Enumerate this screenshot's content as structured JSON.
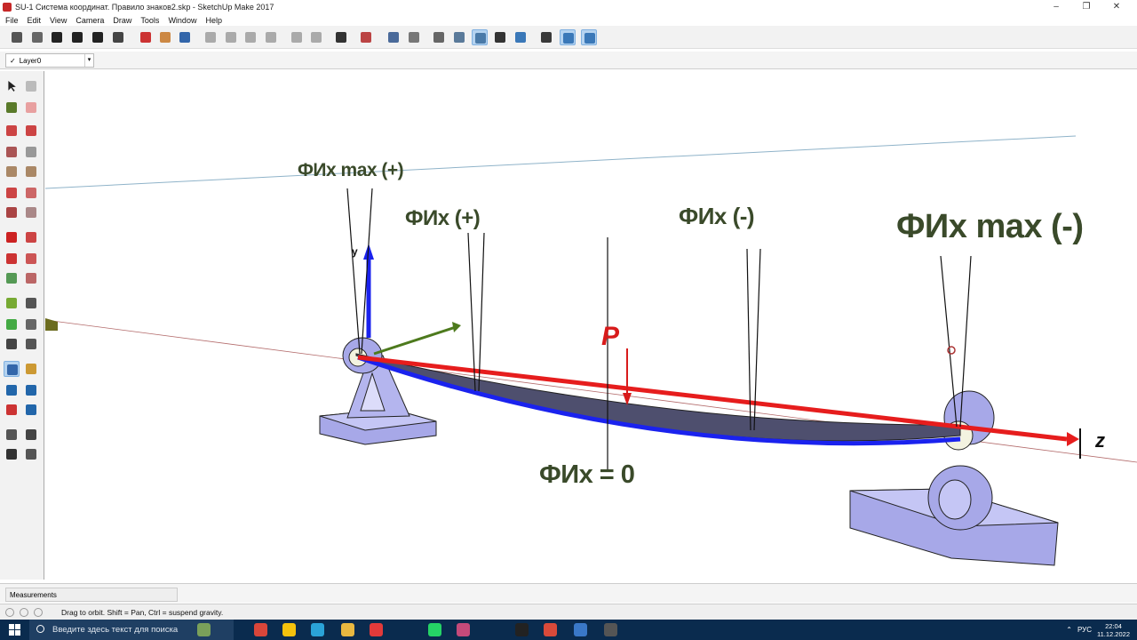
{
  "window": {
    "title": "SU-1 Система координат. Правило знаков2.skp - SketchUp Make 2017",
    "controls": [
      "–",
      "❐",
      "✕"
    ]
  },
  "menu": [
    "File",
    "Edit",
    "View",
    "Camera",
    "Draw",
    "Tools",
    "Window",
    "Help"
  ],
  "toolbar": {
    "icons": [
      "get-models-icon",
      "components-icon",
      "warehouse-icon",
      "home-icon",
      "house-icon",
      "iso-view-icon",
      "new-icon",
      "open-icon",
      "save-icon",
      "cut-icon",
      "copy-icon",
      "paste-icon",
      "erase-icon",
      "undo-icon",
      "redo-icon",
      "print-icon",
      "model-info-icon",
      "xray-icon",
      "back-edges-icon",
      "wireframe-icon",
      "hidden-line-icon",
      "shaded-icon",
      "shaded-textures-icon",
      "monochrome-icon",
      "section-plane-icon",
      "section-cuts-icon",
      "section-fill-icon"
    ],
    "active": [
      "shaded-icon",
      "section-cuts-icon",
      "section-fill-icon"
    ]
  },
  "layer": {
    "check": "✓",
    "name": "Layer0"
  },
  "left_tools": [
    "select-icon",
    "make-component-icon",
    "paint-bucket-icon",
    "eraser-icon",
    "pencil-icon",
    "freehand-icon",
    "rectangle-icon",
    "rotated-rectangle-icon",
    "circle-icon",
    "polygon-icon",
    "arc-icon",
    "two-point-arc-icon",
    "three-point-arc-icon",
    "pie-icon",
    "move-icon",
    "push-pull-icon",
    "rotate-icon",
    "follow-me-icon",
    "scale-icon",
    "offset-icon",
    "tape-measure-icon",
    "dimension-icon",
    "protractor-icon",
    "text-icon",
    "axes-icon",
    "3d-text-icon",
    "orbit-icon",
    "pan-icon",
    "zoom-icon",
    "zoom-window-icon",
    "zoom-extents-icon",
    "previous-view-icon",
    "position-camera-icon",
    "look-around-icon",
    "walk-icon",
    "section-plane-tool-icon"
  ],
  "scene": {
    "labels": {
      "phi_max_plus": "ФИх max (+)",
      "phi_plus": "ФИх (+)",
      "phi_minus": "ФИх (-)",
      "phi_max_minus": "ФИх max (-)",
      "phi_zero": "ФИх = 0",
      "load": "P",
      "axis_y": "y",
      "axis_z": "z"
    }
  },
  "measurements": {
    "label": "Measurements"
  },
  "status": {
    "hint": "Drag to orbit. Shift = Pan, Ctrl = suspend gravity."
  },
  "taskbar": {
    "search_placeholder": "Введите здесь текст для поиска",
    "language": "РУС",
    "time": "22:04",
    "date": "11.12.2022"
  }
}
